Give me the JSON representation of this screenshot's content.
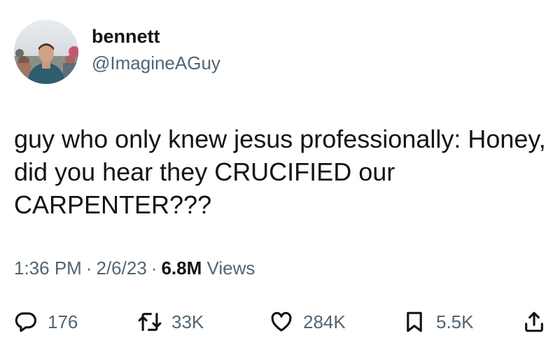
{
  "user": {
    "display_name": "bennett",
    "handle": "@ImagineAGuy"
  },
  "tweet": {
    "text_lines": [
      "guy who only knew jesus professionally: Honey,",
      "did you hear they CRUCIFIED our",
      "CARPENTER???"
    ],
    "time": "1:36 PM",
    "date": "2/6/23",
    "separator": "·",
    "views_count": "6.8M",
    "views_label": "Views"
  },
  "actions": {
    "replies": "176",
    "retweets": "33K",
    "likes": "284K",
    "bookmarks": "5.5K"
  },
  "icons": [
    "reply-icon",
    "retweet-icon",
    "like-icon",
    "bookmark-icon",
    "share-icon"
  ],
  "colors": {
    "text_primary": "#0f1419",
    "text_secondary": "#536471",
    "background": "#ffffff"
  }
}
